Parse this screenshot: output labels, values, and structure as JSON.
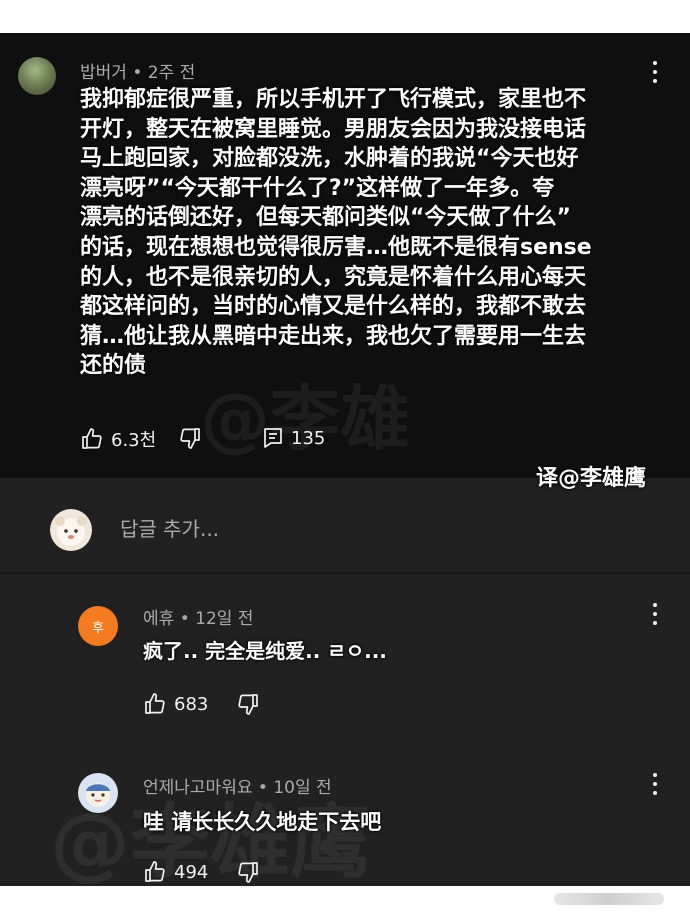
{
  "main_comment": {
    "author": "밥버거",
    "time": "2주 전",
    "text": "我抑郁症很严重，所以手机开了飞行模式，家里也不\n开灯，整天在被窝里睡觉。男朋友会因为我没接电话\n马上跑回家，对脸都没洗，水肿着的我说“今天也好\n漂亮呀”“今天都干什么了?”这样做了一年多。夸\n漂亮的话倒还好，但每天都问类似“今天做了什么”\n的话，现在想想也觉得很厉害…他既不是很有sense\n的人，也不是很亲切的人，究竟是怀着什么用心每天\n都这样问的，当时的心情又是什么样的，我都不敢去\n猜…他让我从黑暗中走出来，我也欠了需要用一生去\n还的债",
    "likes": "6.3천",
    "replies": "135"
  },
  "translator_credit": "译@李雄鹰",
  "reply_box": {
    "placeholder": "답글 추가..."
  },
  "comments": [
    {
      "author": "에휴",
      "time": "12일 전",
      "avatar_text": "후",
      "text": "疯了.. 完全是纯爱.. ㄹㅇ...",
      "likes": "683"
    },
    {
      "author": "언제나고마워요",
      "time": "10일 전",
      "text": "哇 请长长久久地走下去吧",
      "likes": "494"
    }
  ],
  "icons": [
    "kebab-menu-icon",
    "thumb-up-icon",
    "thumb-down-icon",
    "reply-count-icon"
  ],
  "colors": {
    "background": "#0f0f0f",
    "reply_area": "#212121",
    "meta_text": "#aaaaaa",
    "text": "#ffffff",
    "avatar_accent": "#f47b20"
  }
}
